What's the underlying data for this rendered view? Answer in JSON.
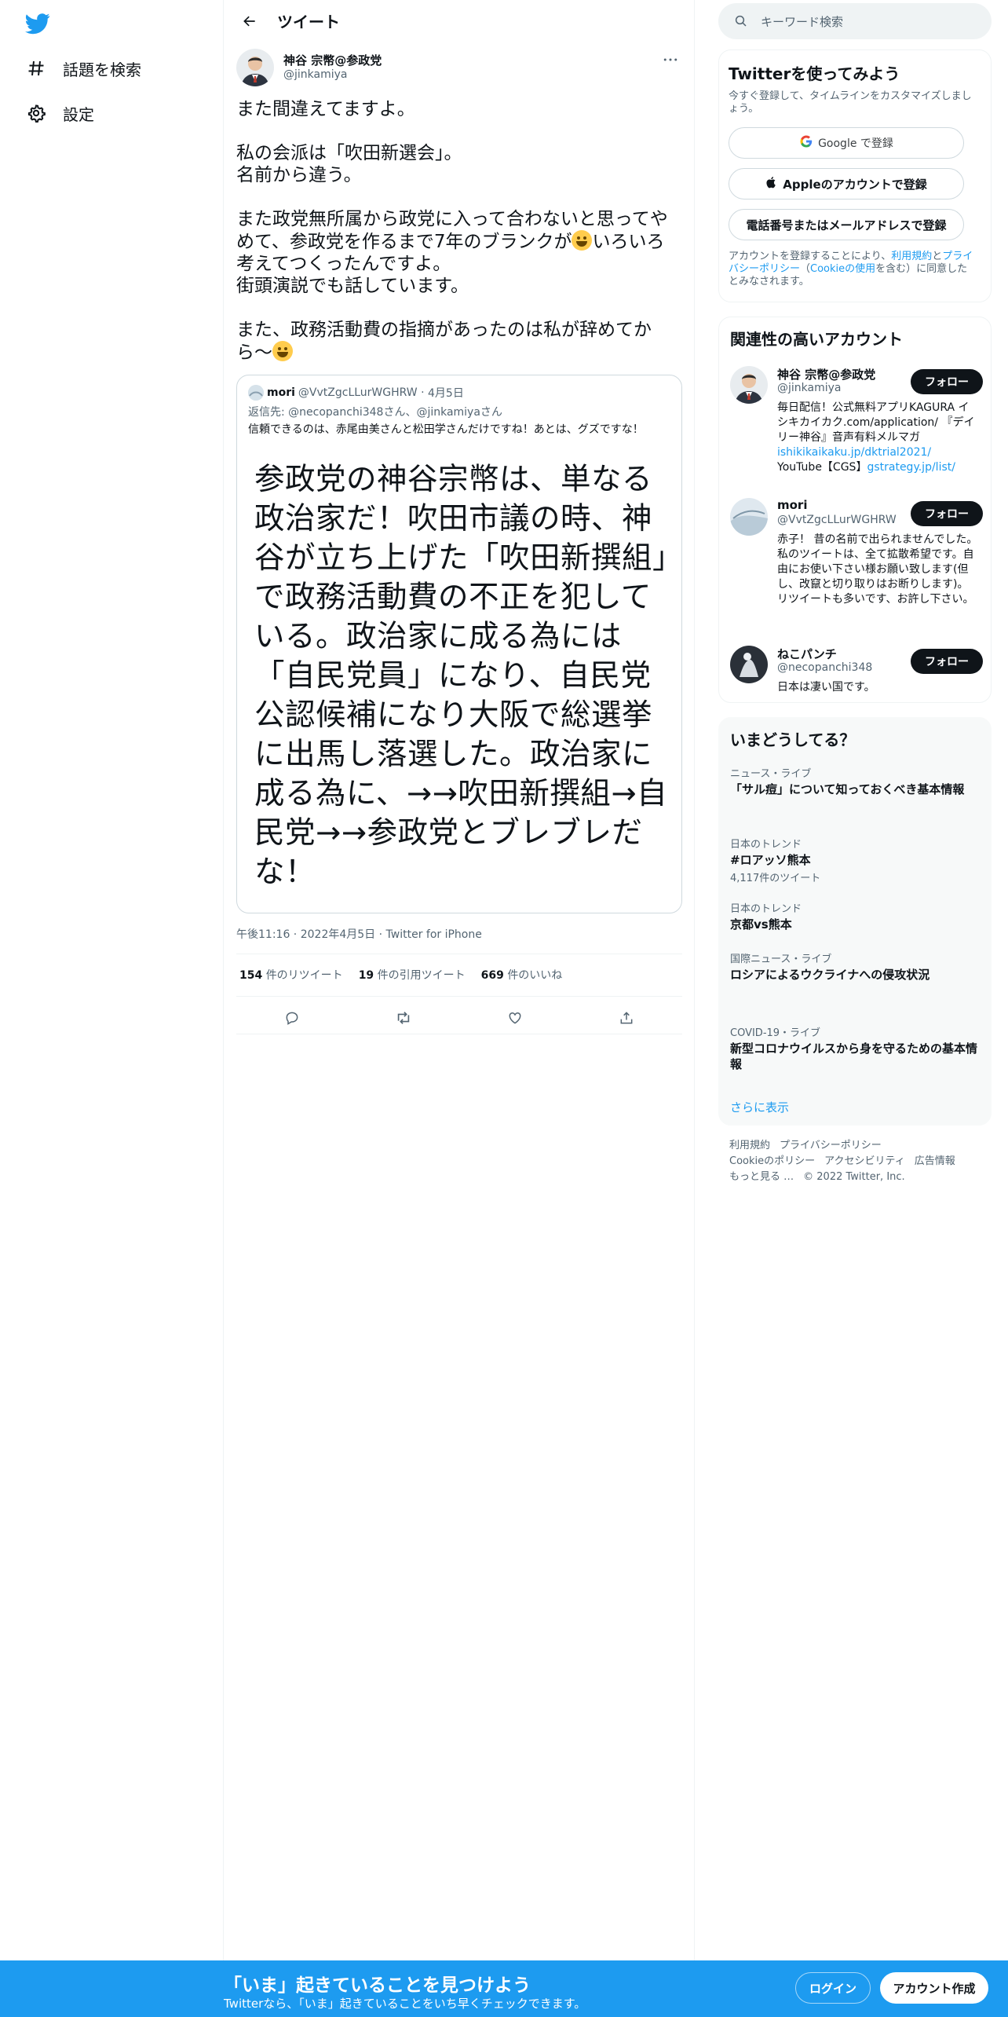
{
  "nav": {
    "logo": "twitter-bird-logo",
    "items": [
      {
        "label": "話題を検索",
        "icon": "hashtag-icon"
      },
      {
        "label": "設定",
        "icon": "gear-icon"
      }
    ]
  },
  "header": {
    "title": "ツイート"
  },
  "tweet": {
    "author_name": "神谷 宗幣@参政党",
    "author_handle": "@jinkamiya",
    "paragraphs": [
      "また間違えてますよ。",
      "私の会派は「吹田新選会」。\n名前から違う。",
      "また政党無所属から政党に入って合わないと思ってやめて、参政党を作るまで7年のブランクが",
      "いろいろ考えてつくったんですよ。\n街頭演説でも話しています。",
      "また、政務活動費の指摘があったのは私が辞めてから〜"
    ],
    "timestamp": "午後11:16",
    "date": "2022年4月5日",
    "source": "Twitter for iPhone",
    "stats": {
      "retweets": "154",
      "retweets_label": "件のリツイート",
      "quotes": "19",
      "quotes_label": "件の引用ツイート",
      "likes": "669",
      "likes_label": "件のいいね"
    }
  },
  "quote": {
    "name": "mori",
    "handle": "@VvtZgcLLurWGHRW",
    "date": "4月5日",
    "reply_prefix": "返信先: ",
    "reply_to": "@necopanchi348さん、@jinkamiyaさん",
    "text": "信頼できるのは、赤尾由美さんと松田学さんだけですね！あとは、グズですな！",
    "image_text": "参政党の神谷宗幣は、単なる政治家だ！吹田市議の時、神谷が立ち上げた「吹田新撰組」で政務活動費の不正を犯している。政治家に成る為には「自民党員」になり、自民党公認候補になり大阪で総選挙に出馬し落選した。政治家に成る為に、→→吹田新撰組→自民党→→参政党とブレブレだな！"
  },
  "search": {
    "placeholder": "キーワード検索"
  },
  "signup": {
    "title": "Twitterを使ってみよう",
    "subtitle": "今すぐ登録して、タイムラインをカスタマイズしましょう。",
    "google": "Google で登録",
    "apple": "Appleのアカウントで登録",
    "phone": "電話番号またはメールアドレスで登録",
    "legal_1": "アカウントを登録することにより、",
    "legal_terms": "利用規約",
    "legal_2": "と",
    "legal_privacy": "プライバシーポリシー",
    "legal_3": "（",
    "legal_cookie": "Cookieの使用",
    "legal_4": "を含む）に同意したとみなされます。"
  },
  "relevant": {
    "title": "関連性の高いアカウント",
    "follow_label": "フォロー",
    "accounts": [
      {
        "name": "神谷 宗幣@参政党",
        "handle": "@jinkamiya",
        "bio": "毎日配信！公式無料アプリKAGURA イシキカイカク.com/application/ 『デイリー神谷』音声有料メルマガ ",
        "bio_link1": "ishikikaikaku.jp/dktrial2021/",
        "bio_mid": " YouTube【CGS】",
        "bio_link2": "gstrategy.jp/list/"
      },
      {
        "name": "mori",
        "handle": "@VvtZgcLLurWGHRW",
        "bio": "赤子！ 昔の名前で出られませんでした。 私のツイートは、全て拡散希望です。自由にお使い下さい様お願い致します(但し、改竄と切り取りはお断りします)。リツイートも多いです、お許し下さい。"
      },
      {
        "name": "ねこパンチ",
        "handle": "@necopanchi348",
        "bio": "日本は凄い国です。"
      }
    ]
  },
  "trends": {
    "title": "いまどうしてる？",
    "items": [
      {
        "category": "ニュース・ライブ",
        "title": "「サル痘」について知っておくべき基本情報",
        "count": ""
      },
      {
        "category": "日本のトレンド",
        "title": "#ロアッソ熊本",
        "count": "4,117件のツイート"
      },
      {
        "category": "日本のトレンド",
        "title": "京都vs熊本",
        "count": ""
      },
      {
        "category": "国際ニュース・ライブ",
        "title": "ロシアによるウクライナへの侵攻状況",
        "count": ""
      },
      {
        "category": "COVID-19・ライブ",
        "title": "新型コロナウイルスから身を守るための基本情報",
        "count": ""
      }
    ],
    "show_more": "さらに表示"
  },
  "footer": {
    "links": [
      "利用規約",
      "プライバシーポリシー",
      "Cookieのポリシー",
      "アクセシビリティ",
      "広告情報",
      "もっと見る …"
    ],
    "copyright": "© 2022 Twitter, Inc."
  },
  "bottom": {
    "title": "「いま」起きていることを見つけよう",
    "subtitle": "Twitterなら、「いま」起きていることをいち早くチェックできます。",
    "login": "ログイン",
    "signup": "アカウント作成"
  },
  "colors": {
    "accent": "#1d9bf0",
    "text": "#0f1419",
    "muted": "#536471"
  }
}
